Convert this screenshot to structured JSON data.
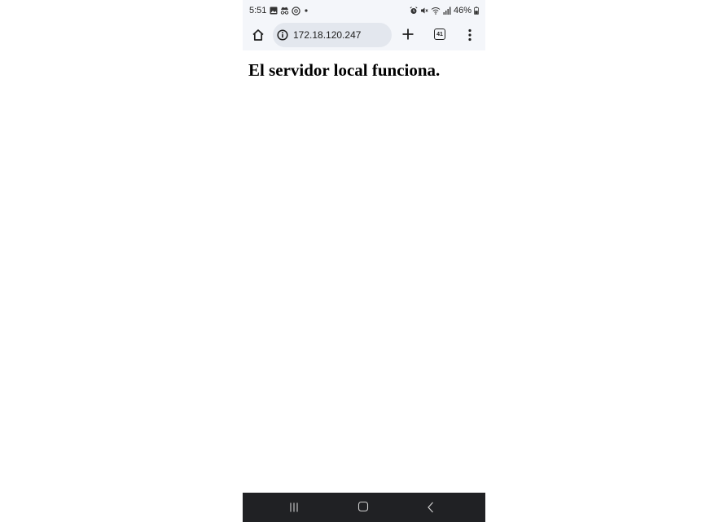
{
  "status_bar": {
    "time": "5:51",
    "battery": "46%",
    "notification_icons": [
      "gallery-icon",
      "incognito-icon",
      "threads-icon",
      "dot-icon"
    ],
    "system_icons": [
      "alarm-icon",
      "mute-icon",
      "wifi-icon",
      "signal-icon",
      "battery-icon"
    ]
  },
  "toolbar": {
    "url": "172.18.120.247",
    "tab_count": "41"
  },
  "page": {
    "heading": "El servidor local funciona."
  },
  "colors": {
    "chrome_bar": "#f4f6fa",
    "url_pill": "#e3e7ee",
    "nav_bar": "#202124"
  }
}
